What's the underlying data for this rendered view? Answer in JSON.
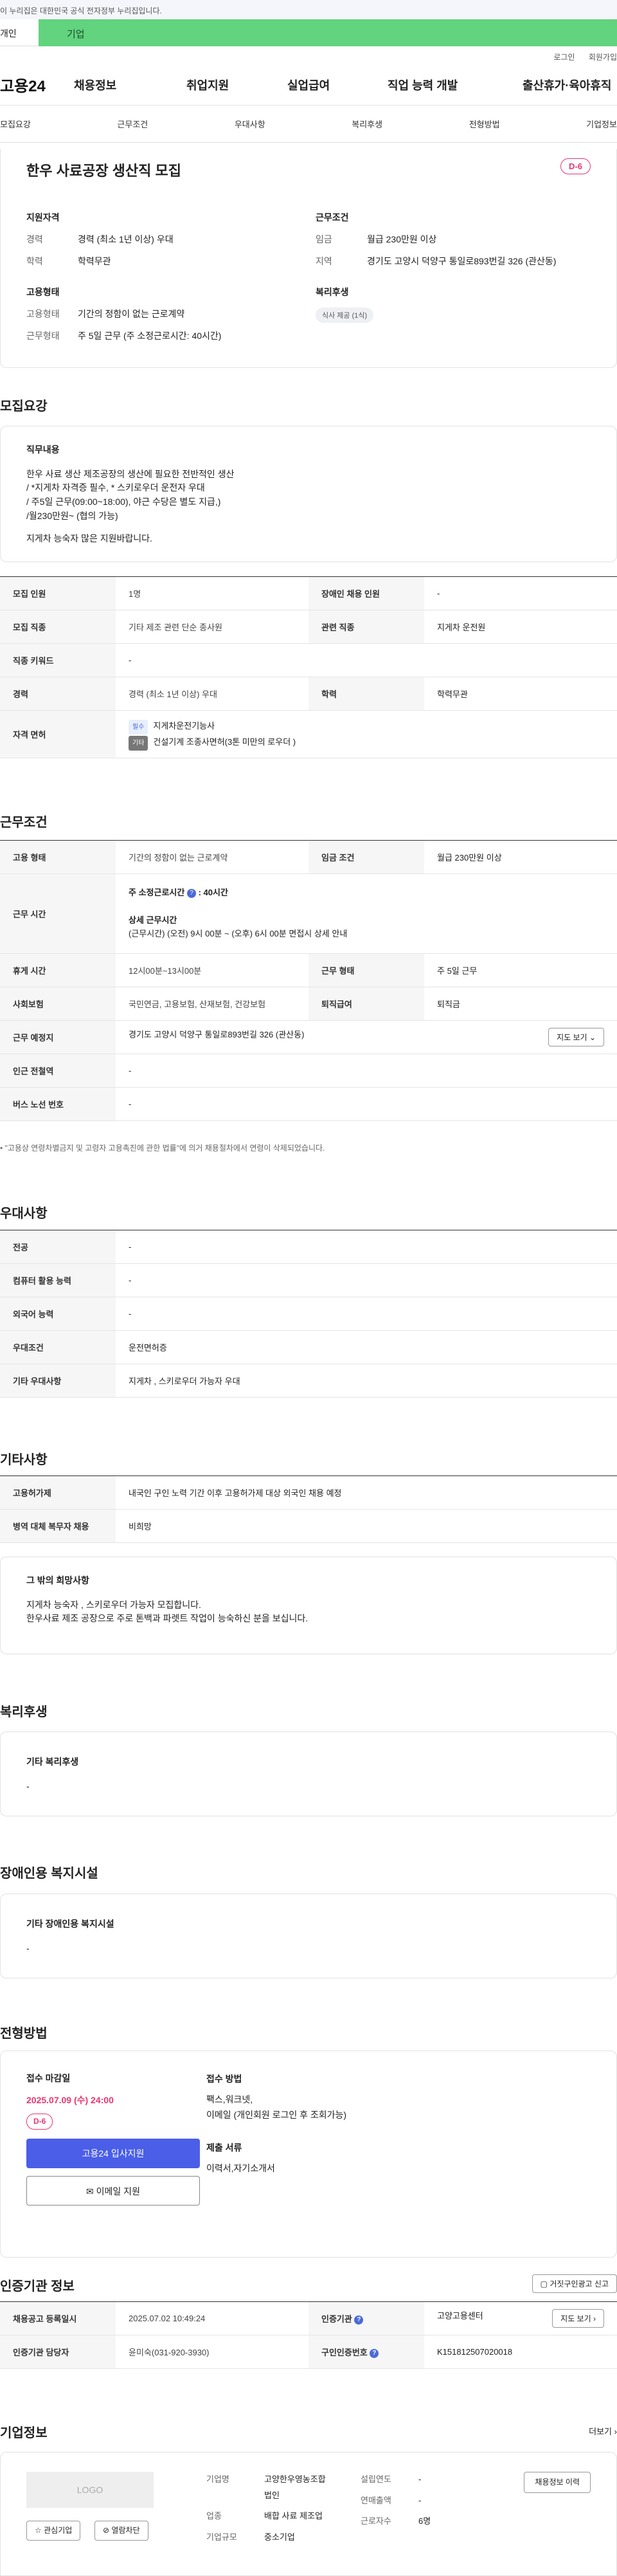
{
  "gov_notice": "이 누리집은 대한민국 공식 전자정부 누리집입니다.",
  "tabs": {
    "person": "개인",
    "company": "기업"
  },
  "util": [
    "로그인",
    "회원가입"
  ],
  "logo": "고용24",
  "gnb": [
    "채용정보",
    "취업지원",
    "실업급여",
    "직업 능력 개발",
    "출산휴가·육아휴직"
  ],
  "anchors": [
    "모집요강",
    "근무조건",
    "우대사항",
    "복리후생",
    "전형방법",
    "기업정보"
  ],
  "summary": {
    "title": "한우 사료공장 생산직 모집",
    "dday": "D-6",
    "qual_h": "지원자격",
    "career_k": "경력",
    "career_v": "경력 (최소 1년 이상) 우대",
    "edu_k": "학력",
    "edu_v": "학력무관",
    "cond_h": "근무조건",
    "wage_k": "임금",
    "wage_v": "월급 230만원 이상",
    "region_k": "지역",
    "region_v": "경기도 고양시 덕양구 통일로893번길 326 (관산동)",
    "emp_h": "고용형태",
    "emptype_k": "고용형태",
    "emptype_v": "기간의 정함이 없는 근로계약",
    "worktype_k": "근무형태",
    "worktype_v": "주 5일 근무 (주 소정근로시간: 40시간)",
    "welfare_h": "복리후생",
    "welfare_chip": "식사 제공 (1식)"
  },
  "recruit": {
    "title": "모집요강",
    "job_h": "직무내용",
    "job_lines": [
      "한우 사료 생산 제조공장의 생산에 필요한 전반적인 생산",
      "/ *지게차 자격증 필수, * 스키로우더 운전자 우대",
      "/ 주5일 근무(09:00~18:00), 야근 수당은  별도 지급,)",
      "/월230만원~ (협의 가능)",
      "",
      " 지게차 능숙자  많은 지원바랍니다."
    ],
    "rows": [
      {
        "h1": "모집 인원",
        "v1": "1명",
        "h2": "장애인 채용 인원",
        "v2": "-"
      },
      {
        "h1": "모집 직종",
        "v1": "기타 제조 관련 단순 종사원",
        "h2": "관련 직종",
        "v2": "지게차 운전원"
      },
      {
        "h1": "직종 키워드",
        "v1": "-"
      },
      {
        "h1": "경력",
        "v1": "경력 (최소 1년 이상) 우대",
        "h2": "학력",
        "v2": "학력무관"
      }
    ],
    "license_h": "자격 면허",
    "license1_tag": "필수",
    "license1": "지게차운전기능사",
    "license2_tag": "기타",
    "license2": "건설기계 조종사면허(3톤 미만의 로우더 )"
  },
  "work": {
    "title": "근무조건",
    "emptype_h": "고용 형태",
    "emptype_v": "기간의 정함이 없는 근로계약",
    "wage_h": "임금 조건",
    "wage_v": "월급 230만원 이상",
    "hours_h": "근무 시간",
    "weekly_label": "주 소정근로시간",
    "weekly_v": ": 40시간",
    "detail_label": "상세 근무시간",
    "detail_v": "(근무시간) (오전) 9시 00분 ~ (오후) 6시 00분 면접시 상세 안내",
    "rest_h": "휴게 시간",
    "rest_v": "12시00분~13시00분",
    "form_h": "근무 형태",
    "form_v": "주 5일 근무",
    "ins_h": "사회보험",
    "ins_v": "국민연금, 고용보험, 산재보험, 건강보험",
    "sev_h": "퇴직급여",
    "sev_v": "퇴직금",
    "loc_h": "근무 예정지",
    "loc_v": "경기도 고양시 덕양구 통일로893번길 326 (관산동)",
    "map_btn": "지도 보기",
    "subway_h": "인근 전철역",
    "subway_v": "-",
    "bus_h": "버스 노선 번호",
    "bus_v": "-",
    "note": "\"고용상 연령차별금지 및 고령자 고용촉진에 관한 법률\"에 의거 채용절차에서 연령이 삭제되었습니다."
  },
  "pref": {
    "title": "우대사항",
    "rows": [
      {
        "h": "전공",
        "v": "-"
      },
      {
        "h": "컴퓨터 활용 능력",
        "v": "-"
      },
      {
        "h": "외국어 능력",
        "v": "-"
      },
      {
        "h": "우대조건",
        "v": "운전면허증"
      },
      {
        "h": "기타 우대사항",
        "v": "지게차  , 스키로우더 가능자 우대"
      }
    ]
  },
  "other": {
    "title": "기타사항",
    "rows": [
      {
        "h": "고용허가제",
        "v": "내국인 구인 노력 기간 이후 고용허가제 대상 외국인 채용 예정"
      },
      {
        "h": "병역 대체 복무자 채용",
        "v": "비희망"
      }
    ],
    "wish_h": "그 밖의 희망사항",
    "wish_lines": [
      "지게차 능숙자 , 스키로우더 가능자 모집합니다.",
      "한우사료 제조 공장으로 주로 톤백과  파렛트 작업이 능숙하신 분을 보십니다."
    ]
  },
  "welfare": {
    "title": "복리후생",
    "h": "기타 복리후생",
    "v": "-"
  },
  "disabled": {
    "title": "장애인용 복지시설",
    "h": "기타 장애인용 복지시설",
    "v": "-"
  },
  "process": {
    "title": "전형방법",
    "deadline_h": "접수 마감일",
    "deadline_v": "2025.07.09 (수) 24:00",
    "dday": "D-6",
    "apply_btn": "고용24 입사지원",
    "email_btn": "이메일 지원",
    "method_h": "접수 방법",
    "method_lines": [
      "팩스,워크넷,",
      "이메일 (개인회원 로그인 후 조회가능)"
    ],
    "docs_h": "제출 서류",
    "docs_v": "이력서,자기소개서"
  },
  "cert": {
    "title": "인증기관 정보",
    "report_btn": "거짓구인광고 신고",
    "reg_h": "채용공고 등록일시",
    "reg_v": "2025.07.02 10:49:24",
    "org_h": "인증기관",
    "org_v": "고양고용센터",
    "map_btn": "지도 보기",
    "mgr_h": "인증기관 담당자",
    "mgr_v": "윤미숙(031-920-3930)",
    "no_h": "구인인증번호",
    "no_v": "K151812507020018"
  },
  "company": {
    "title": "기업정보",
    "more": "더보기",
    "logo": "LOGO",
    "fav_btn": "관심기업",
    "block_btn": "열람차단",
    "name_k": "기업명",
    "name_v1": "고양한우영농조합",
    "name_v2": "법인",
    "ind_k": "업종",
    "ind_v": "배합 사료 제조업",
    "size_k": "기업규모",
    "size_v": "중소기업",
    "year_k": "설립연도",
    "year_v": "-",
    "sales_k": "연매출액",
    "sales_v": "-",
    "emp_k": "근로자수",
    "emp_v": "6명",
    "history_btn": "채용정보 이력"
  }
}
